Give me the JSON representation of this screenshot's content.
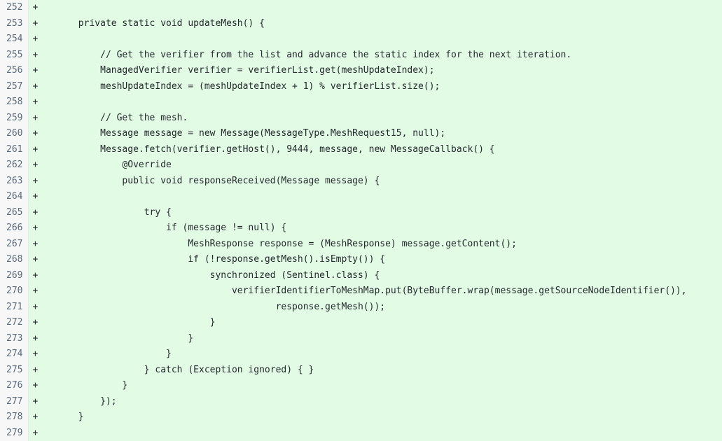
{
  "view": {
    "kind": "unified-diff",
    "language": "java",
    "added_line_marker": "+",
    "colors": {
      "added_background": "#e2fbe4",
      "gutter_background": "#f7f7f7",
      "line_number_text": "#5a6b7b",
      "code_text": "#24292e",
      "gutter_border": "#e3ece3"
    }
  },
  "diff": {
    "rows": [
      {
        "number": "252",
        "marker": "+",
        "code": ""
      },
      {
        "number": "253",
        "marker": "+",
        "code": "    private static void updateMesh() {"
      },
      {
        "number": "254",
        "marker": "+",
        "code": ""
      },
      {
        "number": "255",
        "marker": "+",
        "code": "        // Get the verifier from the list and advance the static index for the next iteration."
      },
      {
        "number": "256",
        "marker": "+",
        "code": "        ManagedVerifier verifier = verifierList.get(meshUpdateIndex);"
      },
      {
        "number": "257",
        "marker": "+",
        "code": "        meshUpdateIndex = (meshUpdateIndex + 1) % verifierList.size();"
      },
      {
        "number": "258",
        "marker": "+",
        "code": ""
      },
      {
        "number": "259",
        "marker": "+",
        "code": "        // Get the mesh."
      },
      {
        "number": "260",
        "marker": "+",
        "code": "        Message message = new Message(MessageType.MeshRequest15, null);"
      },
      {
        "number": "261",
        "marker": "+",
        "code": "        Message.fetch(verifier.getHost(), 9444, message, new MessageCallback() {"
      },
      {
        "number": "262",
        "marker": "+",
        "code": "            @Override"
      },
      {
        "number": "263",
        "marker": "+",
        "code": "            public void responseReceived(Message message) {"
      },
      {
        "number": "264",
        "marker": "+",
        "code": ""
      },
      {
        "number": "265",
        "marker": "+",
        "code": "                try {"
      },
      {
        "number": "266",
        "marker": "+",
        "code": "                    if (message != null) {"
      },
      {
        "number": "267",
        "marker": "+",
        "code": "                        MeshResponse response = (MeshResponse) message.getContent();"
      },
      {
        "number": "268",
        "marker": "+",
        "code": "                        if (!response.getMesh().isEmpty()) {"
      },
      {
        "number": "269",
        "marker": "+",
        "code": "                            synchronized (Sentinel.class) {"
      },
      {
        "number": "270",
        "marker": "+",
        "code": "                                verifierIdentifierToMeshMap.put(ByteBuffer.wrap(message.getSourceNodeIdentifier()),"
      },
      {
        "number": "271",
        "marker": "+",
        "code": "                                        response.getMesh());"
      },
      {
        "number": "272",
        "marker": "+",
        "code": "                            }"
      },
      {
        "number": "273",
        "marker": "+",
        "code": "                        }"
      },
      {
        "number": "274",
        "marker": "+",
        "code": "                    }"
      },
      {
        "number": "275",
        "marker": "+",
        "code": "                } catch (Exception ignored) { }"
      },
      {
        "number": "276",
        "marker": "+",
        "code": "            }"
      },
      {
        "number": "277",
        "marker": "+",
        "code": "        });"
      },
      {
        "number": "278",
        "marker": "+",
        "code": "    }"
      },
      {
        "number": "279",
        "marker": "+",
        "code": ""
      }
    ]
  }
}
